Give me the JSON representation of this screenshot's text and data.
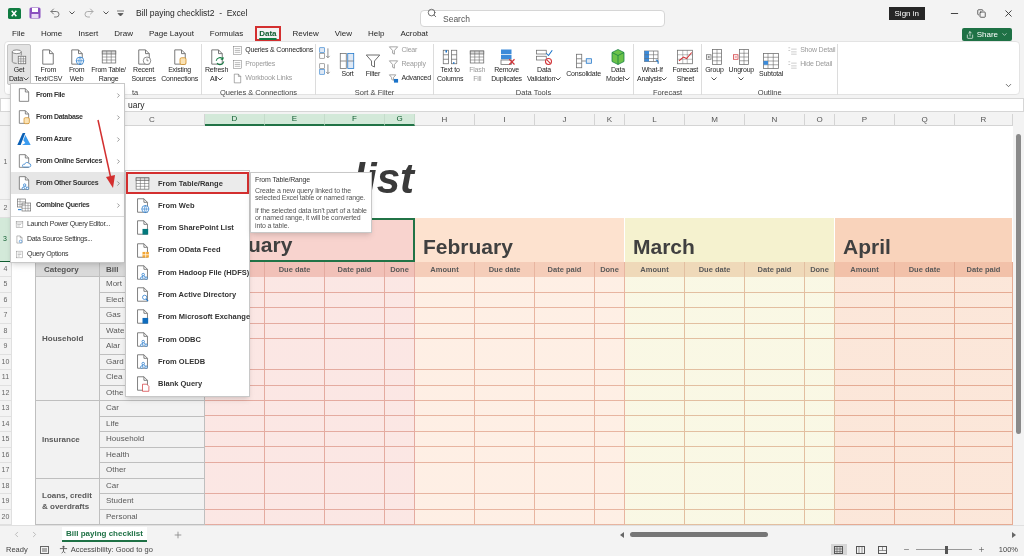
{
  "title_bar": {
    "document_title": "Bill paying checklist2  -  Excel",
    "search": {
      "placeholder": "Search"
    },
    "sign_in": "Sign in"
  },
  "menu_tabs": [
    {
      "label": "File",
      "selected": false,
      "highlighted": false
    },
    {
      "label": "Home",
      "selected": false,
      "highlighted": false
    },
    {
      "label": "Insert",
      "selected": false,
      "highlighted": false
    },
    {
      "label": "Draw",
      "selected": false,
      "highlighted": false
    },
    {
      "label": "Page Layout",
      "selected": false,
      "highlighted": false
    },
    {
      "label": "Formulas",
      "selected": false,
      "highlighted": false
    },
    {
      "label": "Data",
      "selected": true,
      "highlighted": true
    },
    {
      "label": "Review",
      "selected": false,
      "highlighted": false
    },
    {
      "label": "View",
      "selected": false,
      "highlighted": false
    },
    {
      "label": "Help",
      "selected": false,
      "highlighted": false
    },
    {
      "label": "Acrobat",
      "selected": false,
      "highlighted": false
    }
  ],
  "share_button": {
    "label": "Share"
  },
  "ribbon": {
    "groups": [
      {
        "label": "ta",
        "buttons": [
          {
            "kind": "large",
            "lines": [
              "Get",
              "Data"
            ],
            "dropdown": true,
            "pressed": true,
            "disabled": false
          },
          {
            "kind": "large",
            "lines": [
              "From",
              "Text/CSV"
            ],
            "dropdown": false,
            "pressed": false,
            "disabled": false
          },
          {
            "kind": "large",
            "lines": [
              "From",
              "Web"
            ],
            "dropdown": false,
            "pressed": false,
            "disabled": false
          },
          {
            "kind": "large",
            "lines": [
              "From Table/",
              "Range"
            ],
            "dropdown": false,
            "pressed": false,
            "disabled": false
          },
          {
            "kind": "large",
            "lines": [
              "Recent",
              "Sources"
            ],
            "dropdown": false,
            "pressed": false,
            "disabled": false
          },
          {
            "kind": "large",
            "lines": [
              "Existing",
              "Connections"
            ],
            "dropdown": false,
            "pressed": false,
            "disabled": false
          }
        ]
      },
      {
        "label": "Queries & Connections",
        "buttons": [
          {
            "kind": "large",
            "lines": [
              "Refresh",
              "All"
            ],
            "dropdown": true,
            "pressed": false,
            "disabled": false
          },
          {
            "kind": "small",
            "lines": [
              "Queries & Connections"
            ],
            "dropdown": false,
            "pressed": false,
            "disabled": false
          },
          {
            "kind": "small",
            "lines": [
              "Properties"
            ],
            "dropdown": false,
            "pressed": false,
            "disabled": true
          },
          {
            "kind": "small",
            "lines": [
              "Workbook Links"
            ],
            "dropdown": false,
            "pressed": false,
            "disabled": true
          }
        ]
      },
      {
        "label": "Sort & Filter",
        "buttons": [
          {
            "kind": "icon",
            "dropdown": false,
            "pressed": false,
            "disabled": false
          },
          {
            "kind": "icon",
            "dropdown": false,
            "pressed": false,
            "disabled": false
          },
          {
            "kind": "large",
            "lines": [
              "Sort"
            ],
            "dropdown": false,
            "pressed": false,
            "disabled": false
          },
          {
            "kind": "large",
            "lines": [
              "Filter"
            ],
            "dropdown": false,
            "pressed": false,
            "disabled": false
          },
          {
            "kind": "small",
            "lines": [
              "Clear"
            ],
            "dropdown": false,
            "pressed": false,
            "disabled": true
          },
          {
            "kind": "small",
            "lines": [
              "Reapply"
            ],
            "dropdown": false,
            "pressed": false,
            "disabled": true
          },
          {
            "kind": "small",
            "lines": [
              "Advanced"
            ],
            "dropdown": false,
            "pressed": false,
            "disabled": false
          }
        ]
      },
      {
        "label": "Data Tools",
        "buttons": [
          {
            "kind": "large",
            "lines": [
              "Text to",
              "Columns"
            ],
            "dropdown": false,
            "pressed": false,
            "disabled": false
          },
          {
            "kind": "large",
            "lines": [
              "Flash",
              "Fill"
            ],
            "dropdown": false,
            "pressed": false,
            "disabled": true
          },
          {
            "kind": "large",
            "lines": [
              "Remove",
              "Duplicates"
            ],
            "dropdown": false,
            "pressed": false,
            "disabled": false
          },
          {
            "kind": "large",
            "lines": [
              "Data",
              "Validation"
            ],
            "dropdown": true,
            "pressed": false,
            "disabled": false
          },
          {
            "kind": "large",
            "lines": [
              "Consolidate"
            ],
            "dropdown": false,
            "pressed": false,
            "disabled": false
          },
          {
            "kind": "large",
            "lines": [
              "Data",
              "Model"
            ],
            "dropdown": true,
            "pressed": false,
            "disabled": false
          }
        ]
      },
      {
        "label": "Forecast",
        "buttons": [
          {
            "kind": "large",
            "lines": [
              "What-If",
              "Analysis"
            ],
            "dropdown": true,
            "pressed": false,
            "disabled": false
          },
          {
            "kind": "large",
            "lines": [
              "Forecast",
              "Sheet"
            ],
            "dropdown": false,
            "pressed": false,
            "disabled": false
          }
        ]
      },
      {
        "label": "Outline",
        "buttons": [
          {
            "kind": "large",
            "lines": [
              "Group"
            ],
            "dropdown": true,
            "pressed": false,
            "disabled": false
          },
          {
            "kind": "large",
            "lines": [
              "Ungroup"
            ],
            "dropdown": true,
            "pressed": false,
            "disabled": false
          },
          {
            "kind": "large",
            "lines": [
              "Subtotal"
            ],
            "dropdown": false,
            "pressed": false,
            "disabled": false
          },
          {
            "kind": "small",
            "lines": [
              "Show Detail"
            ],
            "dropdown": false,
            "pressed": false,
            "disabled": true
          },
          {
            "kind": "small",
            "lines": [
              "Hide Detail"
            ],
            "dropdown": false,
            "pressed": false,
            "disabled": true
          }
        ]
      }
    ]
  },
  "formula_bar": {
    "value": "uary"
  },
  "column_headers": [
    {
      "label": "C",
      "selected": false
    },
    {
      "label": "D",
      "selected": true
    },
    {
      "label": "E",
      "selected": true
    },
    {
      "label": "F",
      "selected": true
    },
    {
      "label": "G",
      "selected": true
    },
    {
      "label": "H",
      "selected": false
    },
    {
      "label": "I",
      "selected": false
    },
    {
      "label": "J",
      "selected": false
    },
    {
      "label": "K",
      "selected": false
    },
    {
      "label": "L",
      "selected": false
    },
    {
      "label": "M",
      "selected": false
    },
    {
      "label": "N",
      "selected": false
    },
    {
      "label": "O",
      "selected": false
    },
    {
      "label": "P",
      "selected": false
    },
    {
      "label": "Q",
      "selected": false
    },
    {
      "label": "R",
      "selected": false
    }
  ],
  "row_numbers": [
    {
      "label": "1",
      "selected": false
    },
    {
      "label": "2",
      "selected": false
    },
    {
      "label": "3",
      "selected": true
    },
    {
      "label": "4",
      "selected": false
    },
    {
      "label": "5",
      "selected": false
    },
    {
      "label": "6",
      "selected": false
    },
    {
      "label": "7",
      "selected": false
    },
    {
      "label": "8",
      "selected": false
    },
    {
      "label": "9",
      "selected": false
    },
    {
      "label": "10",
      "selected": false
    },
    {
      "label": "11",
      "selected": false
    },
    {
      "label": "12",
      "selected": false
    },
    {
      "label": "13",
      "selected": false
    },
    {
      "label": "14",
      "selected": false
    },
    {
      "label": "15",
      "selected": false
    },
    {
      "label": "16",
      "selected": false
    },
    {
      "label": "17",
      "selected": false
    },
    {
      "label": "18",
      "selected": false
    },
    {
      "label": "19",
      "selected": false
    },
    {
      "label": "20",
      "selected": false
    }
  ],
  "sheet": {
    "title": "list",
    "category_header": "Category",
    "bill_header": "Bill",
    "months": [
      {
        "name": "uary",
        "color": "#f8d3ce",
        "selected": true,
        "columns": [
          "Due date",
          "Date paid",
          "Done"
        ]
      },
      {
        "name": "February",
        "color": "#fde2cf",
        "selected": false,
        "columns": [
          "Amount",
          "Due date",
          "Date paid",
          "Done"
        ]
      },
      {
        "name": "March",
        "color": "#f5f2cf",
        "selected": false,
        "columns": [
          "Amount",
          "Due date",
          "Date paid",
          "Done"
        ]
      },
      {
        "name": "April",
        "color": "#f9d3bb",
        "selected": false,
        "columns": [
          "Amount",
          "Due date",
          "Date paid"
        ]
      }
    ],
    "categories": [
      {
        "name": "Household",
        "bills": [
          "Mort",
          "Elect",
          "Gas",
          "Wate",
          "Alar",
          "Gard",
          "Clea",
          "Othe"
        ]
      },
      {
        "name": "Insurance",
        "bills": [
          "Car",
          "Life",
          "Household",
          "Health",
          "Other"
        ]
      },
      {
        "name": "Loans, credit & overdrafts",
        "bills": [
          "Car",
          "Student",
          "Personal"
        ]
      }
    ]
  },
  "get_data_menu": {
    "items": [
      {
        "label": "From File",
        "kind": "submenu",
        "selected": false
      },
      {
        "label": "From Database",
        "kind": "submenu",
        "selected": false
      },
      {
        "label": "From Azure",
        "kind": "submenu",
        "selected": false
      },
      {
        "label": "From Online Services",
        "kind": "submenu",
        "selected": false
      },
      {
        "label": "From Other Sources",
        "kind": "submenu",
        "selected": true
      },
      {
        "label": "Combine Queries",
        "kind": "submenu",
        "selected": false
      },
      {
        "label": "Launch Power Query Editor...",
        "kind": "command",
        "selected": false
      },
      {
        "label": "Data Source Settings...",
        "kind": "command",
        "selected": false
      },
      {
        "label": "Query Options",
        "kind": "command",
        "selected": false
      }
    ]
  },
  "other_sources_menu": {
    "items": [
      {
        "label": "From Table/Range",
        "selected": true,
        "highlighted": true
      },
      {
        "label": "From Web",
        "selected": false,
        "highlighted": false
      },
      {
        "label": "From SharePoint List",
        "selected": false,
        "highlighted": false
      },
      {
        "label": "From OData Feed",
        "selected": false,
        "highlighted": false
      },
      {
        "label": "From Hadoop File (HDFS)",
        "selected": false,
        "highlighted": false
      },
      {
        "label": "From Active Directory",
        "selected": false,
        "highlighted": false
      },
      {
        "label": "From Microsoft Exchange",
        "selected": false,
        "highlighted": false
      },
      {
        "label": "From ODBC",
        "selected": false,
        "highlighted": false
      },
      {
        "label": "From OLEDB",
        "selected": false,
        "highlighted": false
      },
      {
        "label": "Blank Query",
        "selected": false,
        "highlighted": false
      }
    ]
  },
  "tooltip": {
    "title": "From Table/Range",
    "paragraphs": [
      "Create a new query linked to the selected Excel table or named range.",
      "If the selected data isn't part of a table or named range, it will be converted into a table."
    ]
  },
  "sheet_tabs": [
    {
      "label": "Bill paying checklist",
      "selected": true
    }
  ],
  "status_bar": {
    "mode": "Ready",
    "accessibility": "Accessibility: Good to go",
    "view_buttons": [
      {
        "selected": true
      },
      {
        "selected": false
      },
      {
        "selected": false
      }
    ],
    "zoom_slider": {
      "level": 0.55
    },
    "zoom": "100%"
  }
}
